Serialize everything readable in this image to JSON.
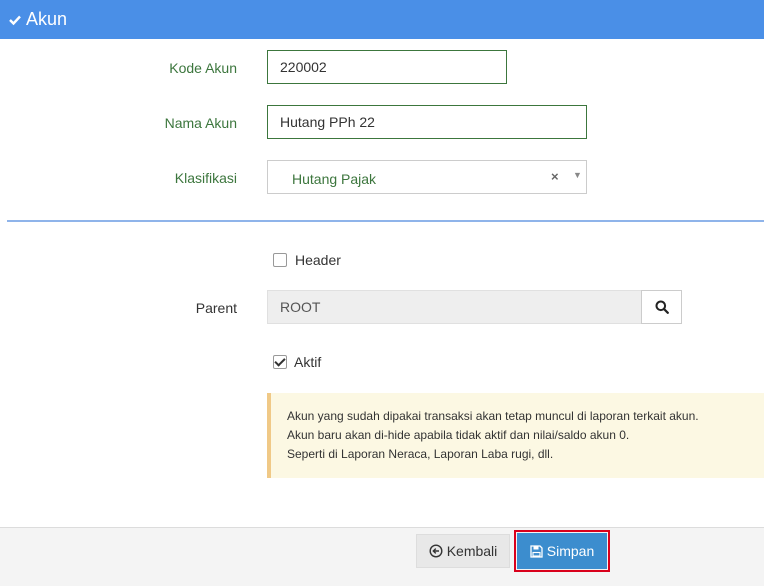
{
  "header": {
    "title": "Akun",
    "icon": "check-icon",
    "color": "#4a8fe7"
  },
  "form": {
    "kode_akun": {
      "label": "Kode Akun",
      "value": "220002"
    },
    "nama_akun": {
      "label": "Nama Akun",
      "value": "Hutang PPh 22"
    },
    "klasifikasi": {
      "label": "Klasifikasi",
      "value": "Hutang Pajak",
      "clear": "×",
      "caret": "▼"
    },
    "header_cb": {
      "label": "Header",
      "checked": false
    },
    "parent": {
      "label": "Parent",
      "value": "ROOT",
      "search_icon": "search-icon"
    },
    "aktif_cb": {
      "label": "Aktif",
      "checked": true
    }
  },
  "alert": {
    "line1": "Akun yang sudah dipakai transaksi akan tetap muncul di laporan terkait akun.",
    "line2": "Akun baru akan di-hide apabila tidak aktif dan nilai/saldo akun 0.",
    "line3": "Seperti di Laporan Neraca, Laporan Laba rugi, dll."
  },
  "footer": {
    "back_label": "Kembali",
    "save_label": "Simpan",
    "save_color": "#3c8dce",
    "highlight_color": "#d9001b"
  }
}
